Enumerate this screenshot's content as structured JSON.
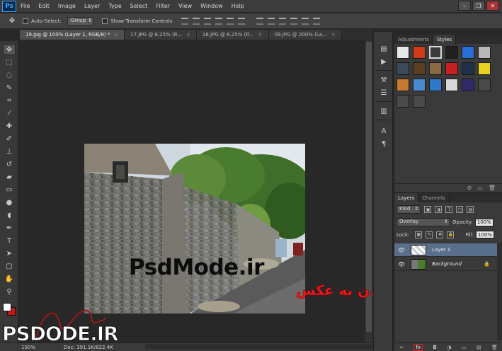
{
  "app": {
    "logo": "Ps",
    "menu": [
      "File",
      "Edit",
      "Image",
      "Layer",
      "Type",
      "Select",
      "Filter",
      "View",
      "Window",
      "Help"
    ],
    "window_controls": [
      "–",
      "❐",
      "✕"
    ]
  },
  "options_bar": {
    "auto_select_label": "Auto-Select:",
    "auto_select_value": "Group",
    "transform_label": "Show Transform Controls"
  },
  "tabs": [
    {
      "label": "19.jpg @ 100% (Layer 1, RGB/8) *",
      "close": "×"
    },
    {
      "label": "17.JPG @ 6.25% (R...",
      "close": "×"
    },
    {
      "label": "16.JPG @ 6.25% (R...",
      "close": "×"
    },
    {
      "label": "09.JPG @ 200% (La...",
      "close": "×"
    }
  ],
  "canvas": {
    "watermark": "PsdMode.ir"
  },
  "annotation": {
    "text": "افکت دادن به عکس"
  },
  "status": {
    "zoom": "100%",
    "doc": "Doc: 391.1K/822.4K"
  },
  "brand": {
    "text": "PSDODE.IR"
  },
  "styles_panel": {
    "tabs": [
      "Adjustments",
      "Styles"
    ],
    "swatch_colors": [
      "#e8e8e8",
      "#d23a1a",
      "#3a3a3a",
      "#202020",
      "#2a6fd8",
      "#b8b8b8",
      "#3a4a5a",
      "#5a4020",
      "#8a6a40",
      "#c82020",
      "#20304a",
      "#e8d020",
      "#c87830",
      "#4a8ad0",
      "#3078c8",
      "#d8d8d8",
      "#302a6a",
      "#4a4a4a",
      "#4a4a4a",
      "#4a4a4a"
    ]
  },
  "layers_panel": {
    "tabs": [
      "Layers",
      "Channels"
    ],
    "filter_kind": "Kind",
    "blend_mode": "Overlay",
    "opacity_label": "Opacity:",
    "opacity_value": "100%",
    "lock_label": "Lock:",
    "fill_label": "Fill:",
    "fill_value": "100%",
    "layers": [
      {
        "name": "Layer 1",
        "selected": true
      },
      {
        "name": "Background",
        "selected": false
      }
    ],
    "footer": [
      "∞",
      "fx",
      "◘",
      "◑",
      "▭",
      "▤",
      "🗑"
    ]
  }
}
